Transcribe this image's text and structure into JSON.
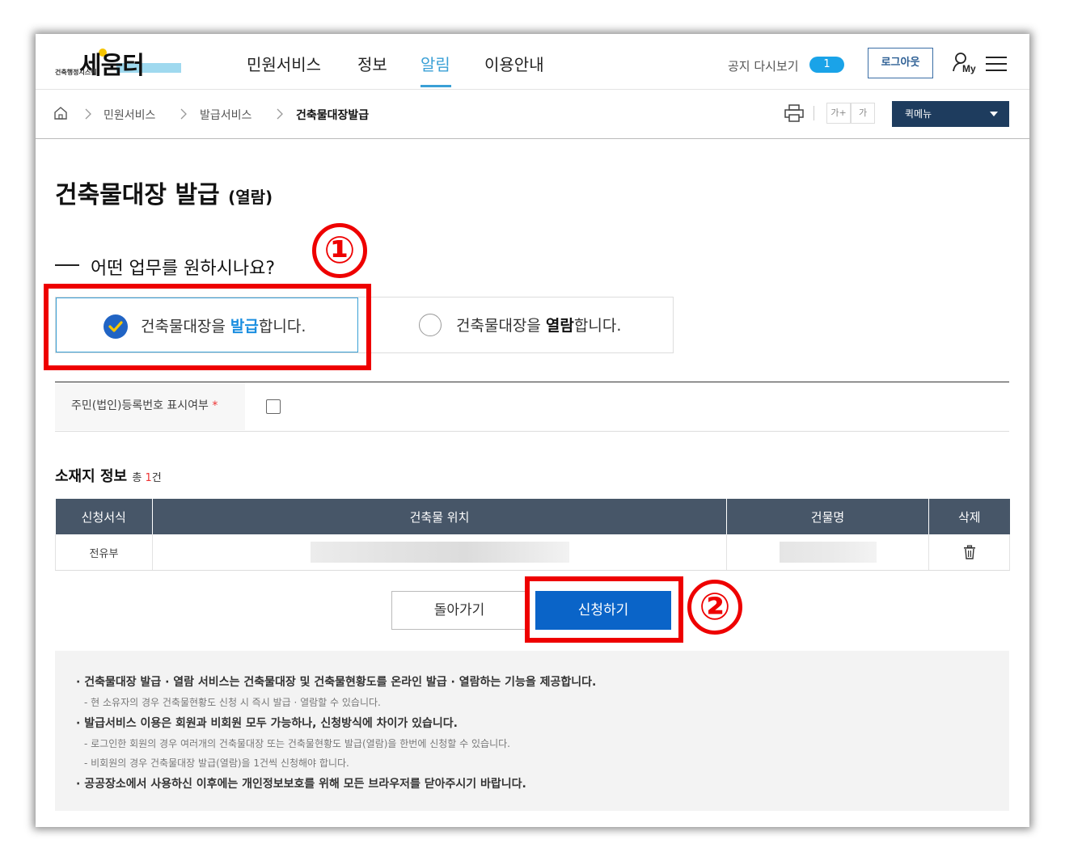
{
  "header": {
    "logo_text": "세움터",
    "logo_sub": "건축행정시스템",
    "nav": [
      "민원서비스",
      "정보",
      "알림",
      "이용안내"
    ],
    "active_nav_index": 2,
    "notice_label": "공지 다시보기",
    "notice_count": "1",
    "logout_label": "로그아웃",
    "my_label": "My"
  },
  "breadcrumb": {
    "items": [
      "민원서비스",
      "발급서비스",
      "건축물대장발급"
    ],
    "font_increase": "가+",
    "font_decrease": "가",
    "quick_menu": "퀵메뉴"
  },
  "page": {
    "title": "건축물대장 발급",
    "title_suffix": "(열람)",
    "question": "어떤 업무를 원하시나요?",
    "marker_1": "①",
    "marker_2": "②"
  },
  "options": [
    {
      "before": "건축물대장을 ",
      "em": "발급",
      "after": "합니다.",
      "selected": true
    },
    {
      "before": "건축물대장을 ",
      "em": "열람",
      "after": "합니다.",
      "selected": false
    }
  ],
  "form": {
    "rrn_label": "주민(법인)등록번호 표시여부",
    "required_mark": "*",
    "rrn_checked": false
  },
  "location": {
    "title": "소재지 정보",
    "count_prefix": "총 ",
    "count": "1",
    "count_suffix": "건",
    "columns": [
      "신청서식",
      "건축물 위치",
      "건물명",
      "삭제"
    ],
    "rows": [
      {
        "form_type": "전유부"
      }
    ]
  },
  "buttons": {
    "back": "돌아가기",
    "apply": "신청하기"
  },
  "info": [
    {
      "type": "main",
      "text": "· 건축물대장 발급 · 열람 서비스는 건축물대장 및 건축물현황도를 온라인 발급 · 열람하는 기능을 제공합니다."
    },
    {
      "type": "sub",
      "text": "- 현 소유자의 경우 건축물현황도 신청 시 즉시 발급 · 열람할 수 있습니다."
    },
    {
      "type": "main",
      "text": "· 발급서비스 이용은 회원과 비회원 모두 가능하나, 신청방식에 차이가 있습니다."
    },
    {
      "type": "sub",
      "text": "- 로그인한 회원의 경우 여러개의 건축물대장 또는 건축물현황도 발급(열람)을 한번에 신청할 수 있습니다."
    },
    {
      "type": "sub",
      "text": "- 비회원의 경우 건축물대장 발급(열람)을 1건씩 신청해야 합니다."
    },
    {
      "type": "main",
      "text": "· 공공장소에서 사용하신 이후에는 개인정보보호를 위해 모든 브라우저를 닫아주시기 바랍니다."
    }
  ],
  "colors": {
    "accent": "#3aa0d6",
    "primary_button": "#0a64c8",
    "table_header": "#475668",
    "highlight_box": "#ee0000",
    "quick_menu": "#1e3c5e"
  }
}
